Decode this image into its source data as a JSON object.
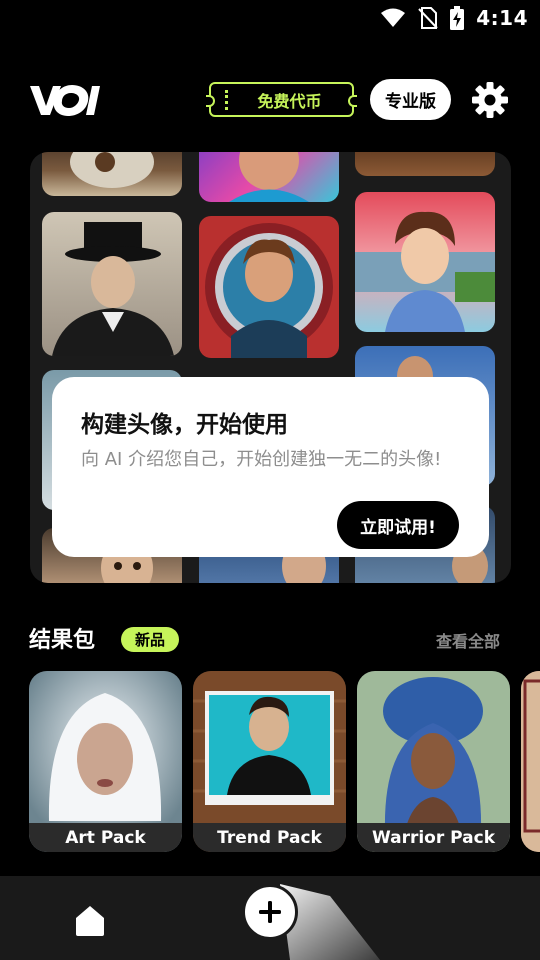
{
  "status_bar": {
    "time": "4:14"
  },
  "header": {
    "logo_text": "VOI",
    "coins_label": "免费代币",
    "pro_label": "专业版"
  },
  "hero": {
    "title": "构建头像，开始使用",
    "description": "向 AI 介绍您自己，开始创建独一无二的头像!",
    "cta_label": "立即试用!"
  },
  "packs_section": {
    "title": "结果包",
    "badge": "新品",
    "see_all": "查看全部",
    "packs": [
      {
        "label": "Art Pack"
      },
      {
        "label": "Trend Pack"
      },
      {
        "label": "Warrior Pack"
      }
    ]
  },
  "icons": {
    "wifi": "wifi-icon",
    "no_sim": "no-sim-icon",
    "battery": "battery-charging-icon",
    "settings": "gear-icon",
    "home": "home-icon",
    "add": "plus-icon"
  },
  "colors": {
    "accent": "#c6f45a",
    "background": "#000000",
    "card": "#ffffff"
  }
}
